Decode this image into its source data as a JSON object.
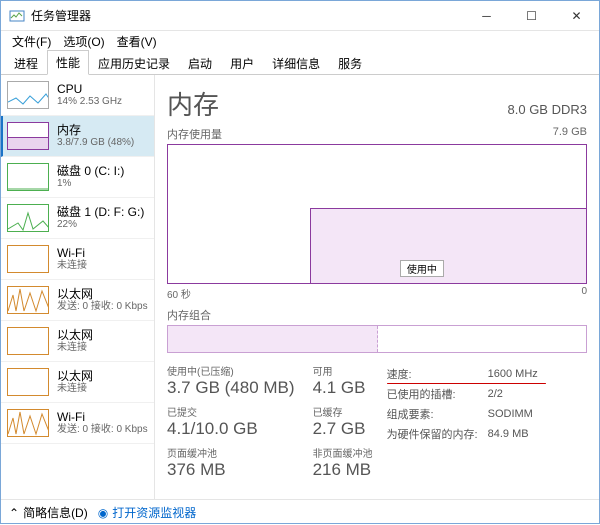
{
  "window": {
    "title": "任务管理器"
  },
  "menu": [
    "文件(F)",
    "选项(O)",
    "查看(V)"
  ],
  "tabs": [
    "进程",
    "性能",
    "应用历史记录",
    "启动",
    "用户",
    "详细信息",
    "服务"
  ],
  "active_tab": 1,
  "sidebar": {
    "items": [
      {
        "name": "CPU",
        "sub": "14% 2.53 GHz",
        "color": "#3aa0d9"
      },
      {
        "name": "内存",
        "sub": "3.8/7.9 GB (48%)",
        "color": "#8b3a9e",
        "selected": true
      },
      {
        "name": "磁盘 0 (C: I:)",
        "sub": "1%",
        "color": "#4caf50"
      },
      {
        "name": "磁盘 1 (D: F: G:)",
        "sub": "22%",
        "color": "#4caf50"
      },
      {
        "name": "Wi-Fi",
        "sub": "未连接",
        "color": "#d38a2e"
      },
      {
        "name": "以太网",
        "sub": "发送: 0 接收: 0 Kbps",
        "color": "#d38a2e"
      },
      {
        "name": "以太网",
        "sub": "未连接",
        "color": "#d38a2e"
      },
      {
        "name": "以太网",
        "sub": "未连接",
        "color": "#d38a2e"
      },
      {
        "name": "Wi-Fi",
        "sub": "发送: 0 接收: 0 Kbps",
        "color": "#d38a2e"
      }
    ]
  },
  "main": {
    "title": "内存",
    "capacity": "8.0 GB DDR3",
    "graph_title": "内存使用量",
    "graph_max": "7.9 GB",
    "xaxis_left": "60 秒",
    "xaxis_right": "0",
    "in_use_label": "使用中",
    "slots_title": "内存组合",
    "stats": {
      "in_use_label": "使用中(已压缩)",
      "in_use_value": "3.7 GB (480 MB)",
      "available_label": "可用",
      "available_value": "4.1 GB",
      "committed_label": "已提交",
      "committed_value": "4.1/10.0 GB",
      "cached_label": "已缓存",
      "cached_value": "2.7 GB",
      "paged_label": "页面缓冲池",
      "paged_value": "376 MB",
      "nonpaged_label": "非页面缓冲池",
      "nonpaged_value": "216 MB"
    },
    "specs": {
      "speed_label": "速度:",
      "speed_value": "1600 MHz",
      "slots_label": "已使用的插槽:",
      "slots_value": "2/2",
      "form_label": "组成要素:",
      "form_value": "SODIMM",
      "reserved_label": "为硬件保留的内存:",
      "reserved_value": "84.9 MB"
    }
  },
  "chart_data": {
    "type": "area",
    "title": "内存使用量",
    "ylabel": "GB",
    "ylim": [
      0,
      7.9
    ],
    "xlim_seconds": [
      60,
      0
    ],
    "series": [
      {
        "name": "使用中",
        "note": "starts ~0 for first ~20s then steps to ~3.8 GB",
        "approx_before": 0,
        "approx_after": 3.8,
        "step_at_seconds": 40
      }
    ]
  },
  "footer": {
    "less_info": "简略信息(D)",
    "open_monitor": "打开资源监视器"
  }
}
